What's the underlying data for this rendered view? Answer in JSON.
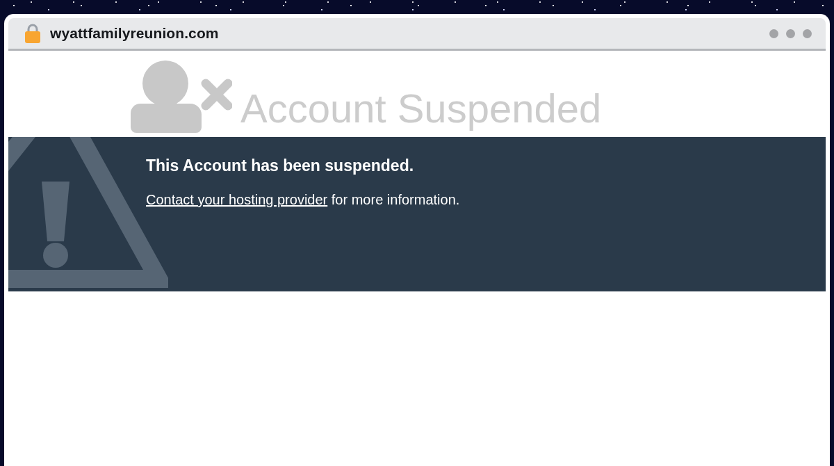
{
  "browser": {
    "url": "wyattfamilyreunion.com"
  },
  "page": {
    "heading": "Account Suspended",
    "notice": {
      "title": "This Account has been suspended.",
      "link": "Contact your hosting provider",
      "text": "for more information."
    }
  }
}
